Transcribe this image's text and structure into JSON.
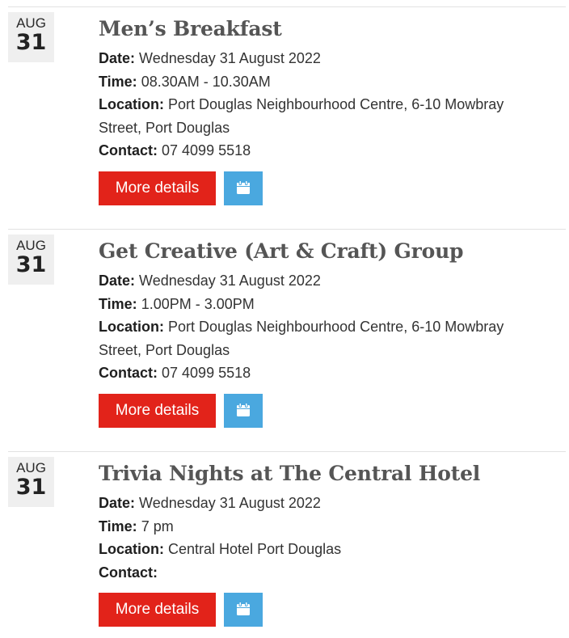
{
  "labels": {
    "date": "Date:",
    "time": "Time:",
    "location": "Location:",
    "contact": "Contact:",
    "more_details": "More details"
  },
  "colors": {
    "more_button": "#e2231a",
    "calendar_button": "#4aa8df",
    "date_badge_bg": "#efefef",
    "title": "#555555"
  },
  "events": [
    {
      "month": "AUG",
      "day": "31",
      "title": "Men’s Breakfast",
      "date": "Wednesday 31 August 2022",
      "time": "08.30AM - 10.30AM",
      "location_line1": "Port Douglas Neighbourhood Centre, 6-10 Mowbray",
      "location_line2": "Street, Port Douglas",
      "contact": "07 4099 5518",
      "calendar_icon": "calendar-icon"
    },
    {
      "month": "AUG",
      "day": "31",
      "title": "Get Creative (Art & Craft) Group",
      "date": "Wednesday 31 August 2022",
      "time": "1.00PM - 3.00PM",
      "location_line1": "Port Douglas Neighbourhood Centre, 6-10 Mowbray",
      "location_line2": "Street, Port Douglas",
      "contact": "07 4099 5518",
      "calendar_icon": "calendar-icon"
    },
    {
      "month": "AUG",
      "day": "31",
      "title": "Trivia Nights at The Central Hotel",
      "date": "Wednesday 31 August 2022",
      "time": "7 pm",
      "location_line1": "Central Hotel Port Douglas",
      "contact": "",
      "calendar_icon": "calendar-icon"
    }
  ]
}
